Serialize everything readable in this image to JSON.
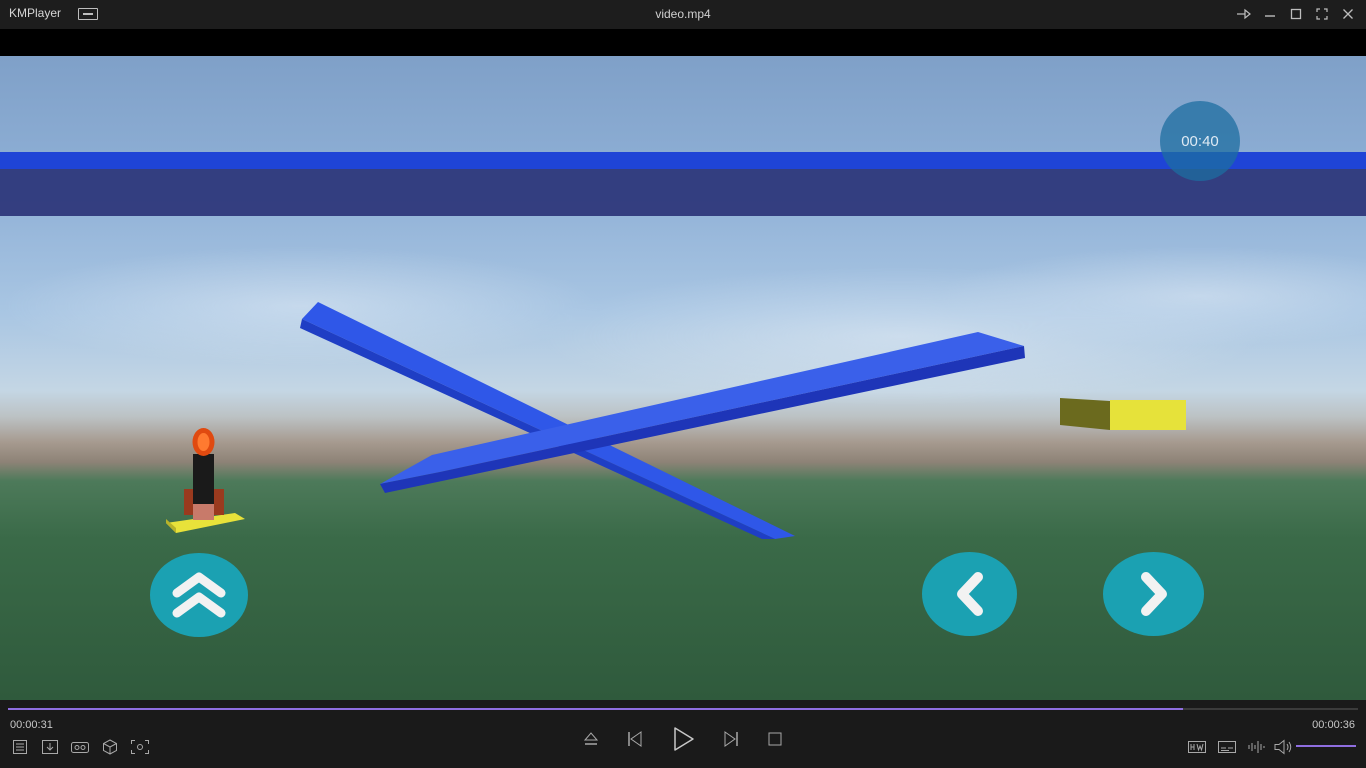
{
  "app": {
    "name": "KMPlayer",
    "title": "video.mp4"
  },
  "video": {
    "timer_label": "00:40"
  },
  "playback": {
    "current_time": "00:00:31",
    "total_time": "00:00:36",
    "progress_fraction": 0.87,
    "volume_fraction": 1.0
  },
  "icons": {
    "menu": "menu-icon",
    "pin": "pin-icon",
    "minimize": "minimize-icon",
    "maximize": "maximize-icon",
    "fullscreen": "fullscreen-icon",
    "close": "close-icon",
    "playlist": "playlist-icon",
    "download": "download-icon",
    "vr": "vr-icon",
    "3d": "cube-icon",
    "capture": "capture-icon",
    "eject": "eject-icon",
    "prev": "previous-icon",
    "play": "play-icon",
    "next": "next-icon",
    "stop": "stop-icon",
    "hw": "hw-decoder-icon",
    "subtitle": "subtitle-icon",
    "equalizer": "equalizer-icon",
    "volume": "volume-icon"
  },
  "colors": {
    "accent": "#8f6ee0",
    "game_button": "#1ba1b2",
    "ceiling": "#1f44d6",
    "beam": "#2f4fe0",
    "block": "#e4e03a"
  }
}
